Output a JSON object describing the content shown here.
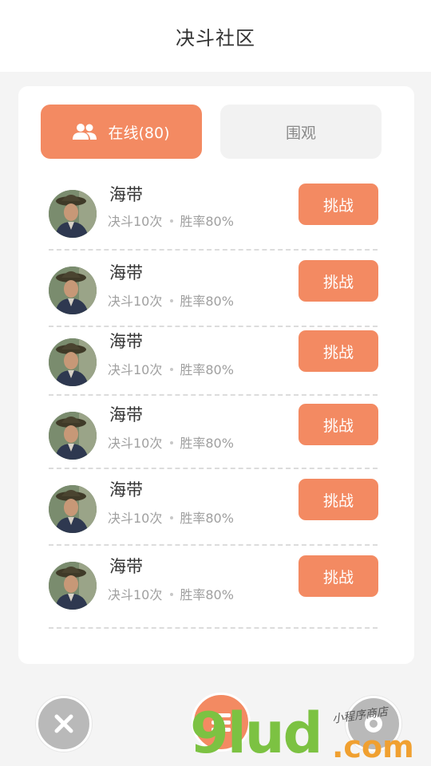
{
  "header": {
    "title": "决斗社区"
  },
  "tabs": [
    {
      "label": "在线(80)",
      "icon": "people-icon",
      "active": true
    },
    {
      "label": "围观",
      "active": false
    }
  ],
  "players": [
    {
      "name": "海带",
      "duels": "决斗10次",
      "winrate": "胜率80%",
      "action": "挑战"
    },
    {
      "name": "海带",
      "duels": "决斗10次",
      "winrate": "胜率80%",
      "action": "挑战"
    },
    {
      "name": "海带",
      "duels": "决斗10次",
      "winrate": "胜率80%",
      "action": "挑战"
    },
    {
      "name": "海带",
      "duels": "决斗10次",
      "winrate": "胜率80%",
      "action": "挑战"
    },
    {
      "name": "海带",
      "duels": "决斗10次",
      "winrate": "胜率80%",
      "action": "挑战"
    },
    {
      "name": "海带",
      "duels": "决斗10次",
      "winrate": "胜率80%",
      "action": "挑战"
    }
  ],
  "bottom_bar": {
    "left_icon": "close-icon",
    "center_icon": "menu-icon",
    "right_icon": "circle-icon"
  },
  "watermark": {
    "brand": "9lud",
    "domain": ".com",
    "tagline": "小程序商店"
  },
  "colors": {
    "accent": "#f38a62",
    "inactive": "#f2f2f2",
    "fab_gray": "#b9b9b9"
  }
}
